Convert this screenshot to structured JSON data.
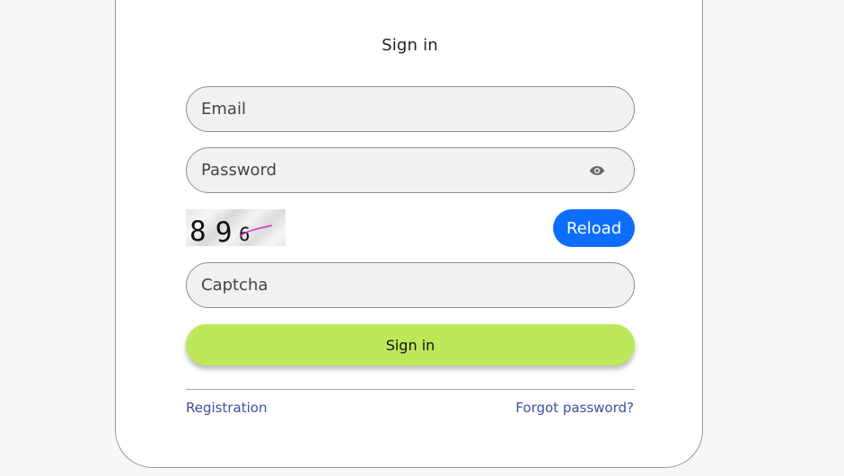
{
  "form": {
    "title": "Sign in",
    "email": {
      "value": "",
      "placeholder": "Email"
    },
    "password": {
      "value": "",
      "placeholder": "Password",
      "toggle_icon": "eye-icon"
    },
    "captcha": {
      "image_text": "896",
      "reload_label": "Reload",
      "input": {
        "value": "",
        "placeholder": "Captcha"
      }
    },
    "submit_label": "Sign in",
    "links": {
      "registration": "Registration",
      "forgot_password": "Forgot password?"
    }
  },
  "colors": {
    "page_background": "#f7f7fa",
    "card_background": "#ffffff",
    "field_background": "#f1f1f1",
    "reload_button": "#0d6efd",
    "submit_button": "#bde85a",
    "link": "#3d4fa8"
  }
}
